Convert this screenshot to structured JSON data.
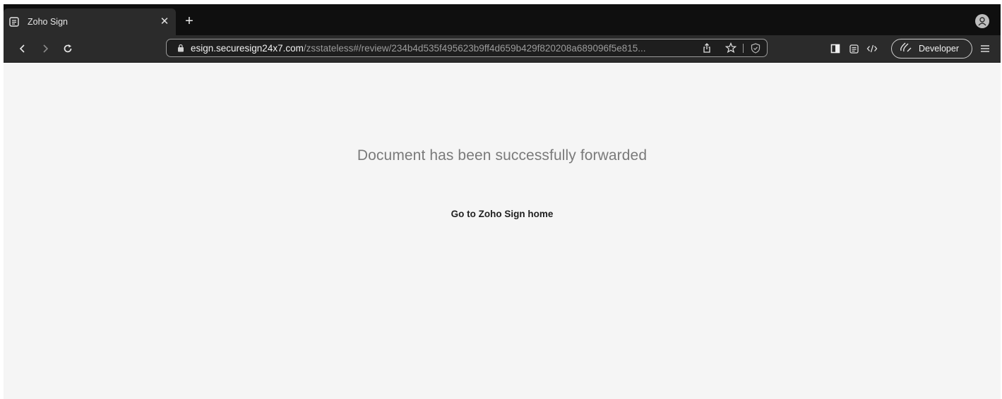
{
  "browser": {
    "tab": {
      "title": "Zoho Sign",
      "favicon": "document-icon"
    },
    "toolbar": {
      "url_host": "esign.securesign24x7.com",
      "url_path": "/zsstateless#/review/234b4d535f495623b9ff4d659b429f820208a689096f5e815...",
      "developer_label": "Developer"
    },
    "colors": {
      "tabstrip": "#0f0f0f",
      "toolbar": "#2b2b2b",
      "page_background": "#f5f5f5"
    }
  },
  "page": {
    "message": "Document has been successfully forwarded",
    "home_link": "Go to Zoho Sign home"
  }
}
